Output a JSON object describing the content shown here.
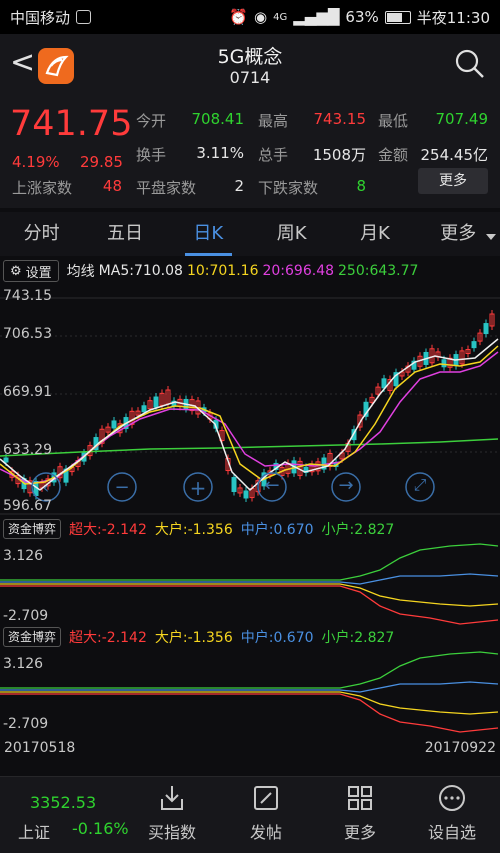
{
  "status": {
    "carrier": "中国移动",
    "battery": "63%",
    "time": "半夜11:30",
    "network": "4G"
  },
  "header": {
    "title": "5G概念",
    "code": "0714"
  },
  "quote": {
    "price": "741.75",
    "change_pct": "4.19%",
    "change_val": "29.85",
    "fields": [
      {
        "label": "今开",
        "value": "708.41",
        "color": "green"
      },
      {
        "label": "最高",
        "value": "743.15",
        "color": "red"
      },
      {
        "label": "最低",
        "value": "707.49",
        "color": "green"
      },
      {
        "label": "换手",
        "value": "3.11%",
        "color": "white"
      },
      {
        "label": "总手",
        "value": "1508万",
        "color": "white"
      },
      {
        "label": "金额",
        "value": "254.45亿",
        "color": "white"
      },
      {
        "label": "上涨家数",
        "value": "48",
        "color": "red"
      },
      {
        "label": "平盘家数",
        "value": "2",
        "color": "white"
      },
      {
        "label": "下跌家数",
        "value": "8",
        "color": "green"
      }
    ],
    "more_label": "更多"
  },
  "tabs": [
    "分时",
    "五日",
    "日K",
    "周K",
    "月K",
    "更多"
  ],
  "active_tab": "日K",
  "ma": {
    "settings_label": "设置",
    "label": "均线",
    "ma5": "MA5:710.08",
    "ma10": "10:701.16",
    "ma20": "20:696.48",
    "ma250": "250:643.77"
  },
  "axis_labels": [
    "743.15",
    "706.53",
    "669.91",
    "633.29",
    "596.67"
  ],
  "fund_flow": {
    "button_label": "资金博弈",
    "super_large": "超大:-2.142",
    "large": "大户:-1.356",
    "medium": "中户:0.670",
    "small": "小户:2.827",
    "ymax": "3.126",
    "ymin": "-2.709"
  },
  "dates": {
    "start": "20170518",
    "end": "20170922"
  },
  "bottom": {
    "index_value": "3352.53",
    "index_name": "上证",
    "index_change": "-0.16%",
    "items": [
      "买指数",
      "发帖",
      "更多",
      "设自选"
    ]
  },
  "colors": {
    "up": "#ff3b3b",
    "down": "#2fd22f",
    "accent": "#4a90e2",
    "ma5": "#e6e6e6",
    "ma10": "#f5d520",
    "ma20": "#e040e0",
    "ma250": "#3ccf3c"
  }
}
